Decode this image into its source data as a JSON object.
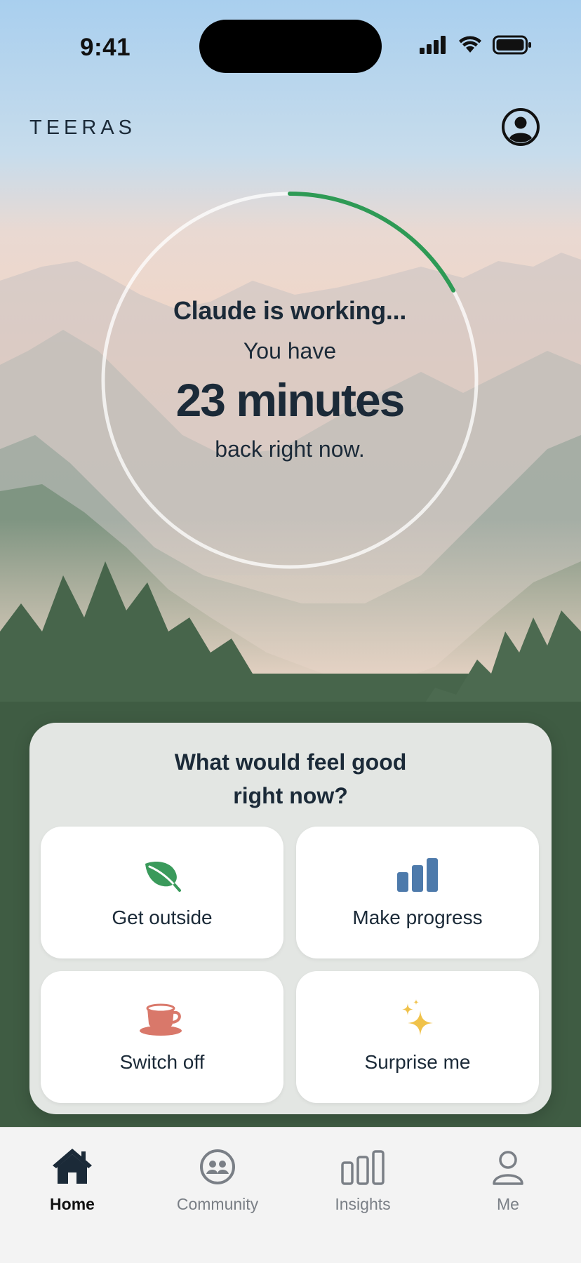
{
  "status_bar": {
    "time": "9:41"
  },
  "header": {
    "brand": "TEERAS",
    "profile_icon": "profile-circle-icon"
  },
  "timer": {
    "status": "Claude is working...",
    "line1": "You have",
    "minutes": "23 minutes",
    "line2": "back right now.",
    "progress": 0.17,
    "progress_color": "#2e9a55"
  },
  "suggestions": {
    "title_line1": "What would feel good",
    "title_line2": "right now?",
    "options": [
      {
        "label": "Get outside",
        "icon": "leaf-icon",
        "color": "#3a9a5b"
      },
      {
        "label": "Make progress",
        "icon": "bar-chart-icon",
        "color": "#4d7aab"
      },
      {
        "label": "Switch off",
        "icon": "coffee-cup-icon",
        "color": "#d9786a"
      },
      {
        "label": "Surprise me",
        "icon": "sparkles-icon",
        "color": "#f0c24a"
      }
    ]
  },
  "tabs": [
    {
      "label": "Home",
      "icon": "home-icon",
      "active": true
    },
    {
      "label": "Community",
      "icon": "community-icon",
      "active": false
    },
    {
      "label": "Insights",
      "icon": "insights-icon",
      "active": false
    },
    {
      "label": "Me",
      "icon": "person-icon",
      "active": false
    }
  ]
}
